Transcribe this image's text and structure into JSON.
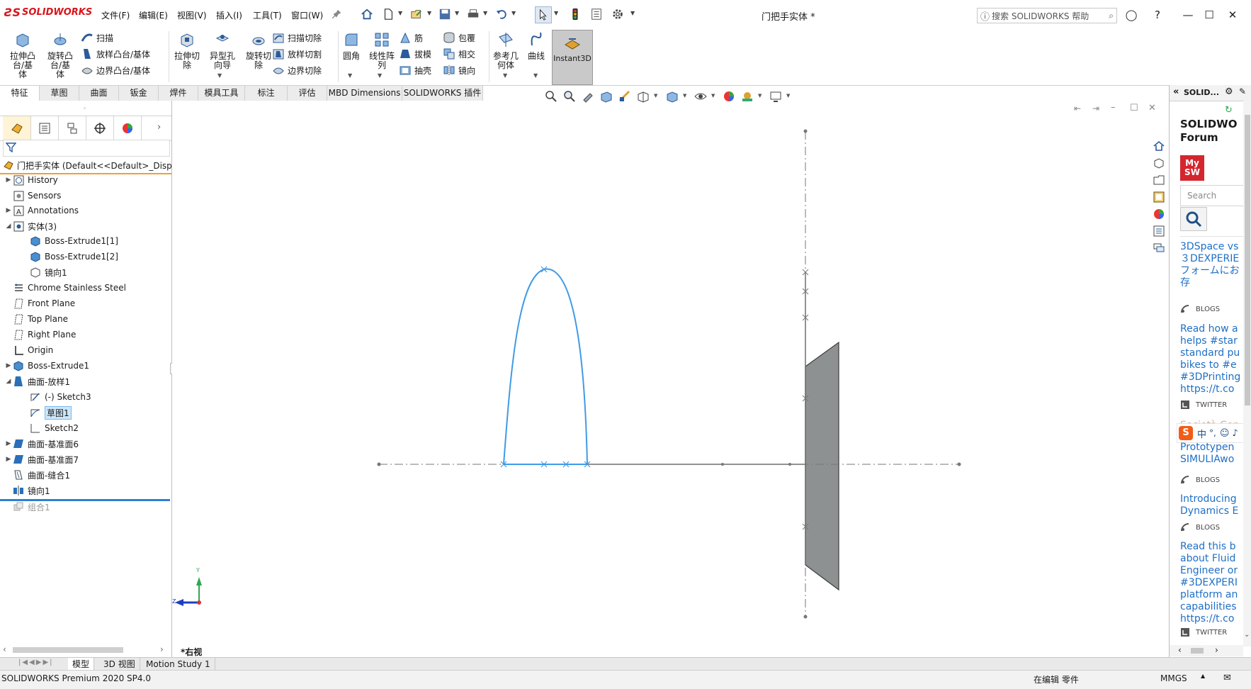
{
  "app": {
    "brand": "SOLIDWORKS",
    "document_title": "门把手实体 *",
    "help_search_placeholder": "搜索 SOLIDWORKS 帮助"
  },
  "menu": [
    "文件(F)",
    "编辑(E)",
    "视图(V)",
    "插入(I)",
    "工具(T)",
    "窗口(W)"
  ],
  "commands": {
    "extrude_boss": "拉伸凸台/基体",
    "revolve_boss": "旋转凸台/基体",
    "sweep": "扫描",
    "loft_boss": "放样凸台/基体",
    "boundary_boss": "边界凸台/基体",
    "extrude_cut": "拉伸切除",
    "hole_wizard": "异型孔向导",
    "revolve_cut": "旋转切除",
    "swept_cut": "扫描切除",
    "lofted_cut": "放样切割",
    "boundary_cut": "边界切除",
    "fillet": "圆角",
    "linear_pattern": "线性阵列",
    "rib": "筋",
    "draft": "拔模",
    "shell": "抽壳",
    "wrap": "包覆",
    "intersect": "相交",
    "mirror": "镜向",
    "reference_geometry": "参考几何体",
    "curves": "曲线",
    "instant3d": "Instant3D"
  },
  "tabs": [
    {
      "label": "特征",
      "active": true
    },
    {
      "label": "草图"
    },
    {
      "label": "曲面"
    },
    {
      "label": "钣金"
    },
    {
      "label": "焊件"
    },
    {
      "label": "模具工具"
    },
    {
      "label": "标注"
    },
    {
      "label": "评估"
    },
    {
      "label": "MBD Dimensions"
    },
    {
      "label": "SOLIDWORKS 插件"
    }
  ],
  "tree": {
    "root": "门把手实体  (Default<<Default>_Disp",
    "items": [
      {
        "label": "History",
        "icon": "history-icon"
      },
      {
        "label": "Sensors",
        "icon": "sensors-icon"
      },
      {
        "label": "Annotations",
        "icon": "annotations-icon"
      },
      {
        "label": "实体(3)",
        "icon": "solid-bodies-icon"
      },
      {
        "label": "Boss-Extrude1[1]",
        "icon": "body-icon"
      },
      {
        "label": "Boss-Extrude1[2]",
        "icon": "body-icon"
      },
      {
        "label": "镜向1",
        "icon": "body-outline-icon"
      },
      {
        "label": "Chrome Stainless Steel",
        "icon": "material-icon"
      },
      {
        "label": "Front Plane",
        "icon": "plane-icon"
      },
      {
        "label": "Top Plane",
        "icon": "plane-icon"
      },
      {
        "label": "Right Plane",
        "icon": "plane-icon"
      },
      {
        "label": "Origin",
        "icon": "origin-icon"
      },
      {
        "label": "Boss-Extrude1",
        "icon": "extrude-icon"
      },
      {
        "label": "曲面-放样1",
        "icon": "surface-loft-icon"
      },
      {
        "label": "(-) Sketch3",
        "icon": "sketch-icon"
      },
      {
        "label": "草图1",
        "icon": "sketch-icon"
      },
      {
        "label": "Sketch2",
        "icon": "sketch-icon"
      },
      {
        "label": "曲面-基准面6",
        "icon": "surface-plane-icon"
      },
      {
        "label": "曲面-基准面7",
        "icon": "surface-plane-icon"
      },
      {
        "label": "曲面-缝合1",
        "icon": "knit-icon"
      },
      {
        "label": "镜向1",
        "icon": "mirror-icon"
      },
      {
        "label": "组合1",
        "icon": "combine-icon"
      }
    ]
  },
  "viewport": {
    "view_label": "*右视",
    "triad_y": "Y",
    "triad_z": "Z"
  },
  "bottom_tabs": [
    "模型",
    "3D 视图",
    "Motion Study 1"
  ],
  "status": {
    "left": "SOLIDWORKS Premium 2020 SP4.0",
    "editing": "在编辑 零件",
    "units": "MMGS"
  },
  "taskpane": {
    "title": "SOLID...",
    "forum_title": "SOLIDWO",
    "forum_sub": "Forum",
    "mysw_line1": "My",
    "mysw_line2": "SW",
    "search_placeholder": "Search",
    "ime": "中",
    "feed": [
      {
        "lines": [
          "3DSpace vs",
          "３DEXPERIE",
          "フォームにお",
          "存"
        ],
        "tag": "BLOGS"
      },
      {
        "lines": [
          "Read how a",
          "helps #star",
          "standard pu",
          "bikes to #e",
          "#3DPrinting",
          "https://t.co"
        ],
        "tag": "TWITTER"
      },
      {
        "lines": [
          "Società Con"
        ],
        "tag": ""
      },
      {
        "lines": [
          "Prototypen",
          "SIMULIAwo"
        ],
        "tag": "BLOGS"
      },
      {
        "lines": [
          "Introducing",
          "Dynamics E"
        ],
        "tag": "BLOGS"
      },
      {
        "lines": [
          "Read this b",
          "about Fluid",
          "Engineer or",
          "#3DEXPERI",
          "platform an",
          "capabilities",
          "https://t.co"
        ],
        "tag": "TWITTER"
      }
    ]
  },
  "colors": {
    "brand_red": "#d8151b",
    "sketch_blue": "#3f9be6",
    "part_gray": "#8e9192",
    "selection": "#cde6fa"
  }
}
